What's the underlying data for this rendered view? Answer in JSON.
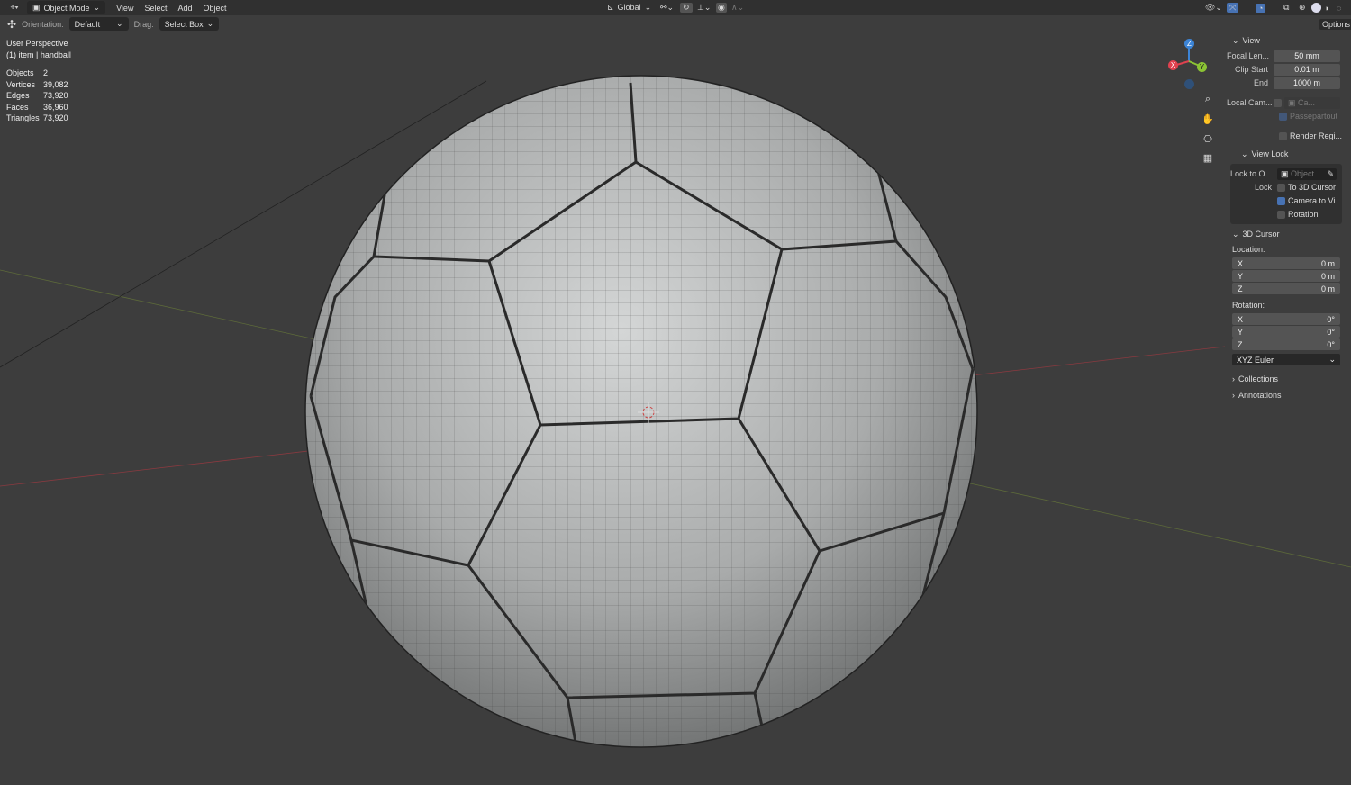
{
  "header": {
    "mode": "Object Mode",
    "menus": [
      "View",
      "Select",
      "Add",
      "Object"
    ],
    "transform_orientation": "Global",
    "options": "Options"
  },
  "toolbar": {
    "orientation_label": "Orientation:",
    "orientation_value": "Default",
    "drag_label": "Drag:",
    "drag_value": "Select Box"
  },
  "overlay": {
    "view_name": "User Perspective",
    "object_info": "(1) item | handball",
    "stats": [
      {
        "k": "Objects",
        "v": "2"
      },
      {
        "k": "Vertices",
        "v": "39,082"
      },
      {
        "k": "Edges",
        "v": "73,920"
      },
      {
        "k": "Faces",
        "v": "36,960"
      },
      {
        "k": "Triangles",
        "v": "73,920"
      }
    ]
  },
  "gizmo": {
    "x": "X",
    "y": "Y",
    "z": "Z"
  },
  "npanel": {
    "view": {
      "title": "View",
      "focal_label": "Focal Len...",
      "focal": "50 mm",
      "clip_start_label": "Clip Start",
      "clip_start": "0.01 m",
      "end_label": "End",
      "end": "1000 m",
      "local_cam_label": "Local Cam...",
      "local_cam_value": "Ca...",
      "passepartout": "Passepartout",
      "render_region": "Render Regi..."
    },
    "view_lock": {
      "title": "View Lock",
      "lock_to_label": "Lock to O...",
      "lock_to_placeholder": "Object",
      "lock_label": "Lock",
      "to_cursor": "To 3D Cursor",
      "camera_to_view": "Camera to Vi...",
      "camera_to_view_checked": true,
      "rotation": "Rotation"
    },
    "cursor": {
      "title": "3D Cursor",
      "location_label": "Location:",
      "loc": [
        {
          "k": "X",
          "v": "0 m"
        },
        {
          "k": "Y",
          "v": "0 m"
        },
        {
          "k": "Z",
          "v": "0 m"
        }
      ],
      "rotation_label": "Rotation:",
      "rot": [
        {
          "k": "X",
          "v": "0°"
        },
        {
          "k": "Y",
          "v": "0°"
        },
        {
          "k": "Z",
          "v": "0°"
        }
      ],
      "rotation_mode": "XYZ Euler"
    },
    "collections": "Collections",
    "annotations": "Annotations"
  },
  "colors": {
    "accent": "#4772b3",
    "x_axis": "#e0414f",
    "y_axis": "#8bc334",
    "z_axis": "#3c84d6",
    "viewport": "#3d3d3d"
  }
}
